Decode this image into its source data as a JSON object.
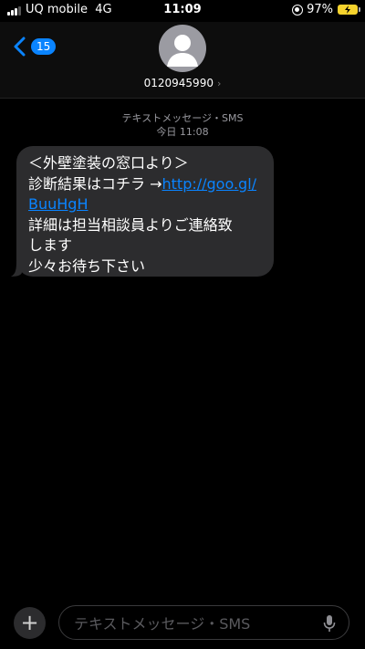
{
  "status_bar": {
    "carrier": "UQ mobile",
    "network": "4G",
    "time": "11:09",
    "battery": "97%"
  },
  "header": {
    "back_count": "15",
    "contact": "0120945990"
  },
  "thread": {
    "service": "テキストメッセージ・SMS",
    "timestamp": "今日 11:08",
    "message": {
      "line1": "＜外壁塗装の窓口より＞",
      "line2_prefix": "診断結果はコチラ →",
      "link_part1": "http://goo.gl/",
      "link_part2": "BuuHgH",
      "line3": "詳細は担当相談員よりご連絡致",
      "line4": "します",
      "line5": "少々お待ち下さい"
    }
  },
  "composer": {
    "placeholder": "テキストメッセージ・SMS"
  },
  "colors": {
    "accent": "#0a84ff",
    "bubble": "#2c2c2e",
    "battery": "#f6d32d"
  },
  "icons": [
    "signal-icon",
    "lock-rotation-icon",
    "battery-icon",
    "back-chevron-icon",
    "avatar-icon",
    "plus-icon",
    "mic-icon"
  ]
}
